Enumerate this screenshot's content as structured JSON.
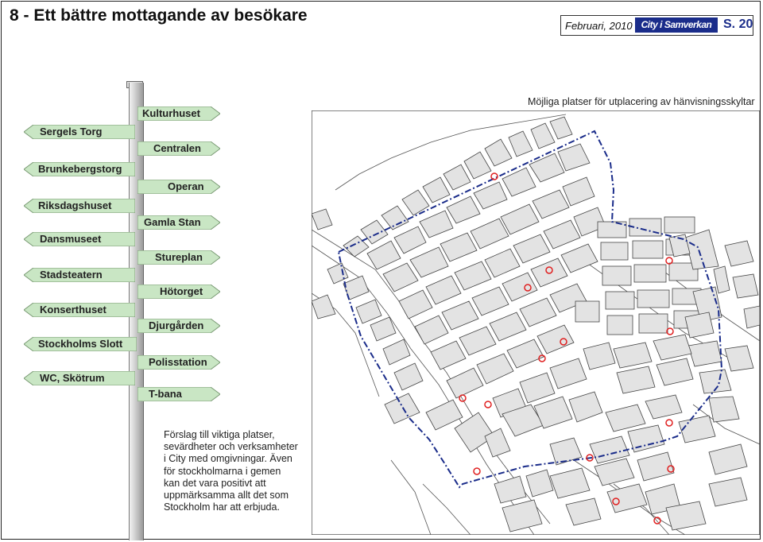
{
  "header": {
    "title": "8 - Ett bättre mottagande av besökare",
    "date": "Februari, 2010",
    "logo": "City i Samverkan",
    "page": "S. 20"
  },
  "map_caption": "Möjliga platser för utplacering av hänvisningsskyltar",
  "signs_left": [
    {
      "label": "Sergels Torg"
    },
    {
      "label": "Brunkebergstorg"
    },
    {
      "label": "Riksdagshuset"
    },
    {
      "label": "Dansmuseet"
    },
    {
      "label": "Stadsteatern"
    },
    {
      "label": "Konserthuset"
    },
    {
      "label": "Stockholms Slott"
    },
    {
      "label": "WC, Skötrum"
    }
  ],
  "signs_right": [
    {
      "label": "Kulturhuset"
    },
    {
      "label": "Centralen"
    },
    {
      "label": "Operan"
    },
    {
      "label": "Gamla Stan"
    },
    {
      "label": "Stureplan"
    },
    {
      "label": "Hötorget"
    },
    {
      "label": "Djurgården"
    },
    {
      "label": "Polisstation"
    },
    {
      "label": "T-bana"
    }
  ],
  "description": "Förslag till viktiga platser, sevärdheter och verksamheter i City med omgivningar. Även för stockholmarna i gemen kan det vara positivt att uppmärksamma allt det som Stockholm har att erbjuda.",
  "colors": {
    "sign_fill": "#c9e6c4",
    "boundary": "#1a2c8a",
    "marker": "#e02020",
    "block_fill": "#e3e3e3"
  },
  "legend": {
    "boundary_line": "dash-dot blue line",
    "marker": "red circle"
  }
}
